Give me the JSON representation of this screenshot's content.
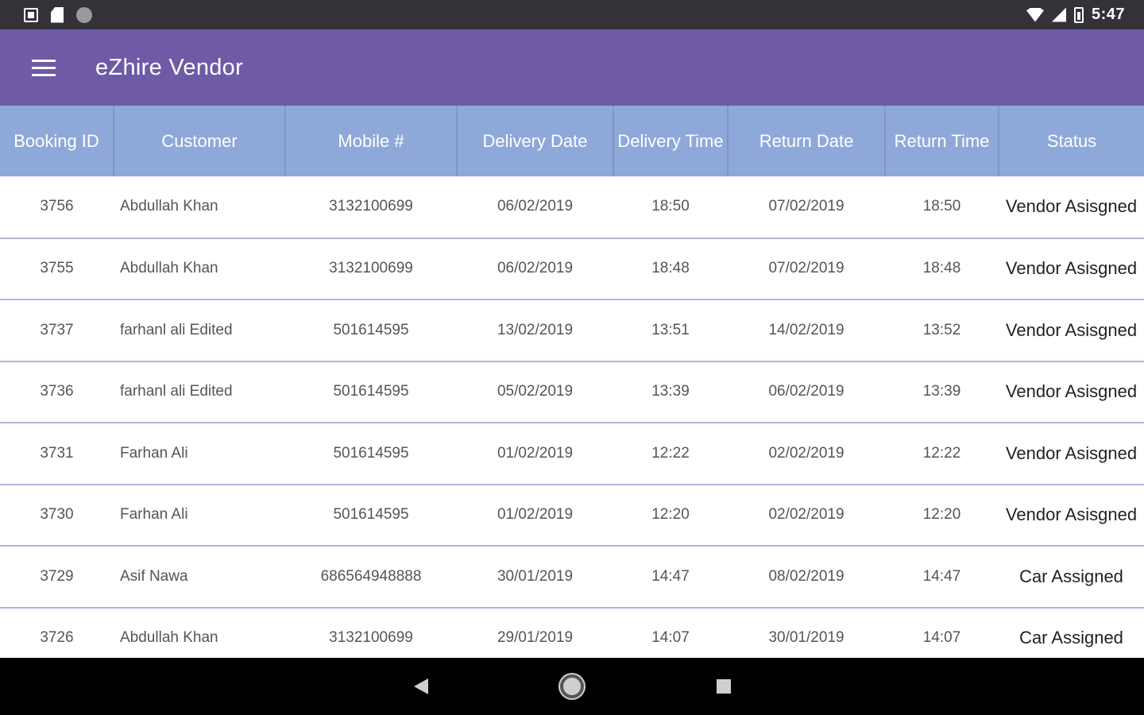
{
  "status_bar": {
    "time": "5:47",
    "icons": [
      "notification-icon",
      "sd-card-icon",
      "circle-icon",
      "wifi-icon",
      "cell-signal-icon",
      "battery-icon"
    ]
  },
  "app_bar": {
    "title": "eZhire Vendor",
    "menu_icon": "hamburger-menu-icon"
  },
  "table": {
    "columns": [
      {
        "label": "Booking ID"
      },
      {
        "label": "Customer"
      },
      {
        "label": "Mobile #"
      },
      {
        "label": "Delivery Date"
      },
      {
        "label": "Delivery Time"
      },
      {
        "label": "Return Date"
      },
      {
        "label": "Return Time"
      },
      {
        "label": "Status"
      }
    ],
    "rows": [
      {
        "id": "3756",
        "customer": "Abdullah Khan",
        "mobile": "3132100699",
        "delivery_date": "06/02/2019",
        "delivery_time": "18:50",
        "return_date": "07/02/2019",
        "return_time": "18:50",
        "status": "Vendor Asisgned"
      },
      {
        "id": "3755",
        "customer": "Abdullah Khan",
        "mobile": "3132100699",
        "delivery_date": "06/02/2019",
        "delivery_time": "18:48",
        "return_date": "07/02/2019",
        "return_time": "18:48",
        "status": "Vendor Asisgned"
      },
      {
        "id": "3737",
        "customer": "farhanl ali Edited",
        "mobile": "501614595",
        "delivery_date": "13/02/2019",
        "delivery_time": "13:51",
        "return_date": "14/02/2019",
        "return_time": "13:52",
        "status": "Vendor Asisgned"
      },
      {
        "id": "3736",
        "customer": "farhanl ali Edited",
        "mobile": "501614595",
        "delivery_date": "05/02/2019",
        "delivery_time": "13:39",
        "return_date": "06/02/2019",
        "return_time": "13:39",
        "status": "Vendor Asisgned"
      },
      {
        "id": "3731",
        "customer": "Farhan Ali",
        "mobile": "501614595",
        "delivery_date": "01/02/2019",
        "delivery_time": "12:22",
        "return_date": "02/02/2019",
        "return_time": "12:22",
        "status": "Vendor Asisgned"
      },
      {
        "id": "3730",
        "customer": "Farhan Ali",
        "mobile": "501614595",
        "delivery_date": "01/02/2019",
        "delivery_time": "12:20",
        "return_date": "02/02/2019",
        "return_time": "12:20",
        "status": "Vendor Asisgned"
      },
      {
        "id": "3729",
        "customer": "Asif Nawa",
        "mobile": "686564948888",
        "delivery_date": "30/01/2019",
        "delivery_time": "14:47",
        "return_date": "08/02/2019",
        "return_time": "14:47",
        "status": "Car Assigned"
      },
      {
        "id": "3726",
        "customer": "Abdullah Khan",
        "mobile": "3132100699",
        "delivery_date": "29/01/2019",
        "delivery_time": "14:07",
        "return_date": "30/01/2019",
        "return_time": "14:07",
        "status": "Car Assigned"
      }
    ]
  },
  "nav_bar": {
    "icons": [
      "back-icon",
      "home-icon",
      "recent-apps-icon"
    ]
  },
  "colors": {
    "app_bar": "#6f5aa6",
    "header": "#8fa8da",
    "row_divider": "#b9b0d8",
    "status_bar": "#343238"
  }
}
